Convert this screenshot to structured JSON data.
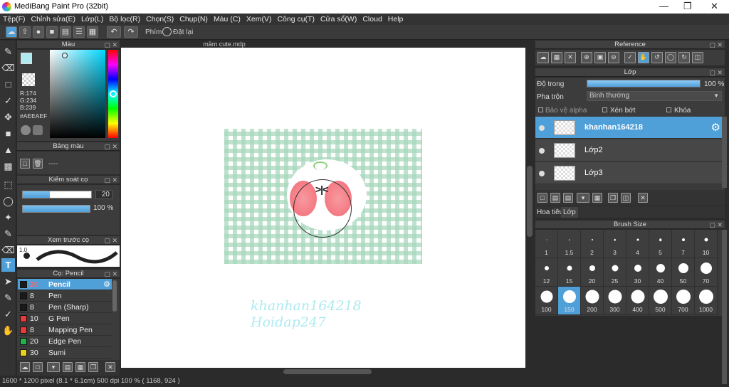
{
  "window": {
    "title": "MediBang Paint Pro (32bit)"
  },
  "menu": [
    "Tệp(F)",
    "Chỉnh sửa(E)",
    "Lớp(L)",
    "Bộ lọc(R)",
    "Chọn(S)",
    "Chụp(N)",
    "Màu (C)",
    "Xem(V)",
    "Công cụ(T)",
    "Cửa sổ(W)",
    "Cloud",
    "Help"
  ],
  "toolbar": {
    "shortcut_label": "Phím",
    "reset_label": "Đặt lại"
  },
  "color_panel": {
    "title": "Màu",
    "r": "R:174",
    "g": "G:234",
    "b": "B:239",
    "hex": "#AEEAEF",
    "current_color": "#aeeaef"
  },
  "palette_panel": {
    "title": "Bảng màu",
    "value": "----"
  },
  "brush_control": {
    "title": "Kiểm soát cọ",
    "size": "20",
    "opacity": "100 %"
  },
  "brush_preview": {
    "title": "Xem trước cọ",
    "size": "1.0"
  },
  "brush_panel": {
    "title": "Cọ: Pencil",
    "items": [
      {
        "size": "20",
        "name": "Pencil",
        "color": "#1a1a1a"
      },
      {
        "size": "8",
        "name": "Pen",
        "color": "#1a1a1a"
      },
      {
        "size": "8",
        "name": "Pen (Sharp)",
        "color": "#1a1a1a"
      },
      {
        "size": "10",
        "name": "G Pen",
        "color": "#e83a3a"
      },
      {
        "size": "8",
        "name": "Mapping Pen",
        "color": "#e83a3a"
      },
      {
        "size": "20",
        "name": "Edge Pen",
        "color": "#21b24a"
      },
      {
        "size": "30",
        "name": "Sumi",
        "color": "#e8d21a"
      }
    ]
  },
  "document": {
    "tab": "mầm cute.mdp",
    "watermark_line1": "khanhan164218",
    "watermark_line2": "Hoidap247"
  },
  "reference_panel": {
    "title": "Reference"
  },
  "layer_panel": {
    "title": "Lớp",
    "opacity_label": "Độ trong",
    "opacity_value": "100 %",
    "opacity_fraction": 1.0,
    "blend_label": "Pha trộn",
    "blend_value": "Bình thường",
    "alpha_label": "Bảo vệ alpha",
    "clip_label": "Xén bớt",
    "lock_label": "Khóa",
    "layers": [
      {
        "name": "khanhan164218"
      },
      {
        "name": "Lớp2"
      },
      {
        "name": "Lớp3"
      }
    ],
    "tab_nav": "Hoa tiêu",
    "tab_layer": "Lớp"
  },
  "brush_size_panel": {
    "title": "Brush Size",
    "sizes": [
      "1",
      "1.5",
      "2",
      "3",
      "4",
      "5",
      "7",
      "10",
      "12",
      "15",
      "20",
      "25",
      "30",
      "40",
      "50",
      "70",
      "100",
      "150",
      "200",
      "300",
      "400",
      "500",
      "700",
      "1000"
    ],
    "selected": "150"
  },
  "status": {
    "text": "1600 * 1200 pixel   (8.1 * 6.1cm)   500 dpi   100 %   ( 1168, 924 )"
  },
  "colors": {
    "accent": "#4f9fd9",
    "gingham": "#a9d8be",
    "cheek": "#f47a82",
    "sprout": "#8fd07a",
    "watermark": "#aeeaef"
  }
}
